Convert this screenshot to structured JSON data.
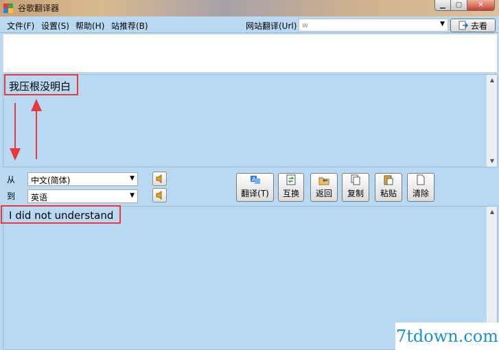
{
  "window": {
    "title": "谷歌翻译器",
    "min": "▁",
    "max": "▢",
    "close": "✕"
  },
  "menu": {
    "file": "文件(F)",
    "settings": "设置(S)",
    "help": "帮助(H)",
    "recommend": "站推荐(B)"
  },
  "url": {
    "label": "网站翻译(Url)",
    "value": "w",
    "go": "去看"
  },
  "source": {
    "text": "我压根没明白"
  },
  "lang": {
    "from_label": "从",
    "to_label": "到",
    "from": "中文(简体)",
    "to": "英语"
  },
  "toolbar": {
    "translate": "翻译(T)",
    "swap": "互换",
    "back": "返回",
    "copy": "复制",
    "paste": "粘贴",
    "clear": "清除"
  },
  "target": {
    "text": "I did not understand"
  },
  "watermark": "7tdown.com",
  "colors": {
    "panel": "#b9d9f3",
    "highlight": "#e8383d",
    "watermark": "#1a8fd8"
  }
}
